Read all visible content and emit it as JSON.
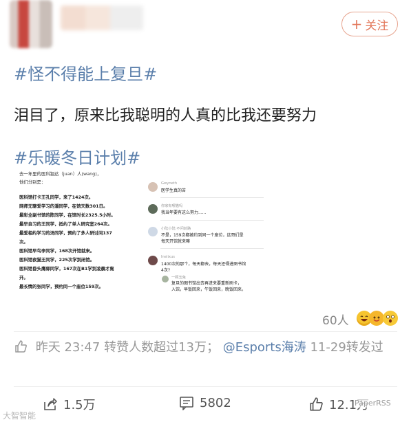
{
  "header": {
    "follow_label": "关注"
  },
  "post": {
    "tag1": "#怪不得能上复旦#",
    "text": "泪目了，原来比我聪明的人真的比我还要努力",
    "tag2": "#乐暖冬日计划#"
  },
  "embedded_left": {
    "intro1": "去一年里的医科猖达（juan）人(wang)，",
    "intro2": "他们分别是：",
    "lines": [
      "医科馆打卡王孔同学，来了1424次。",
      "网师无聊爱学习的潘同学，在馆天数301日。",
      "最彩全副书馆的陈同学，在馆时长2325.5小时。",
      "最早自习的王同学，抵约了单人研究室264次。",
      "最爱相约学习的汤同学，预约了多人研讨间137",
      "次。",
      "医科馆早鸟李同学，168次开馆就来。",
      "医科馆夜猫王同学，225次学到闭馆。",
      "医科馆昏头鹰郭同学，167次在B1学到凌晨才离",
      "开。",
      "最长情的张同学，预约同一个座位159次。"
    ]
  },
  "embedded_right": {
    "comments": [
      {
        "name": "Gwyneth",
        "text": "医学生真的苦"
      },
      {
        "name": "你家有哪猫吗",
        "text": "我当年要有这么努力......"
      },
      {
        "name": "小陆小陆 不问前路",
        "text": "不是，159次都被约到同一个座位，这哥们是",
        "text2": "每天开馆就来嘛"
      },
      {
        "name": "Inelixus",
        "text": "1400次的那个，每天都去，每天还得进图书馆",
        "text2": "4次?"
      },
      {
        "name": "一颗玉兔",
        "text": "复旦的图书馆出去再进来要重新刷卡，",
        "text2": "入馆，早饭回来，午饭回来，晚饭回来。"
      }
    ]
  },
  "reactions": {
    "count": "60人"
  },
  "meta": {
    "time": "昨天 23:47",
    "text": "转赞人数超过13万；",
    "mention": "@Esports海涛",
    "date": "11-29",
    "suffix": "转发过"
  },
  "actions": {
    "share": "1.5万",
    "comment": "5802",
    "like": "12.1万"
  },
  "watermarks": {
    "left": "大智智能",
    "right": "PaperRSS"
  }
}
